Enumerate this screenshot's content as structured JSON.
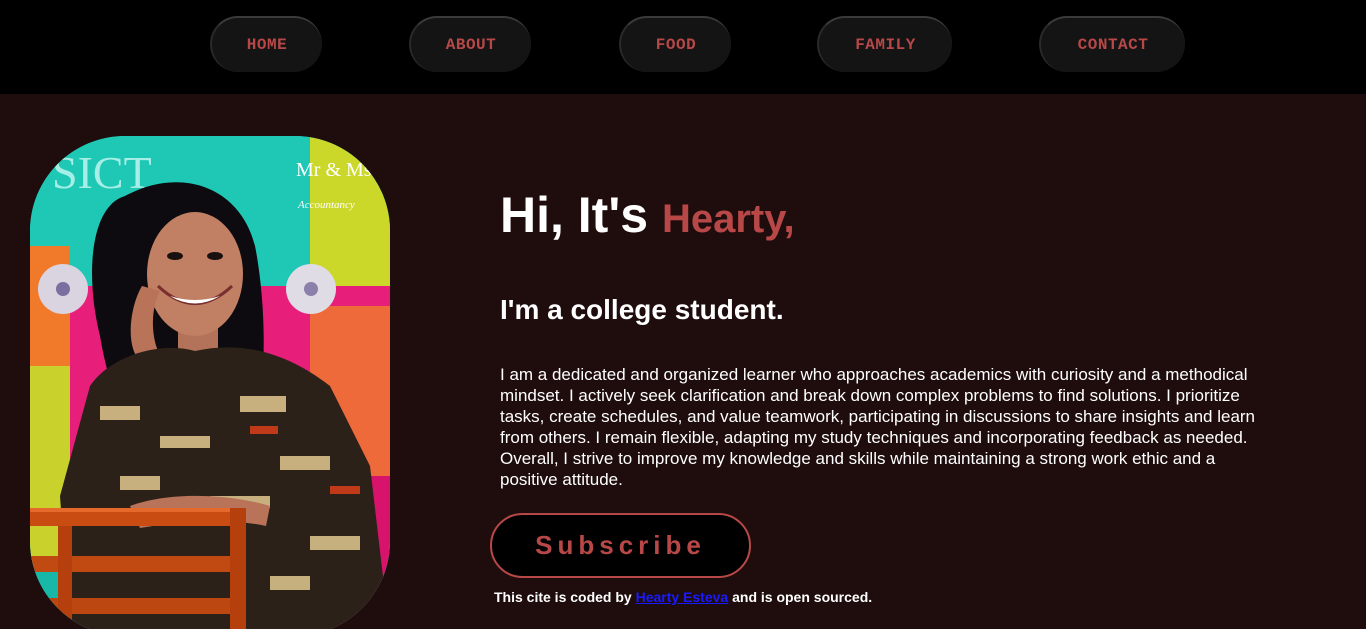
{
  "nav": {
    "items": [
      {
        "label": "HOME"
      },
      {
        "label": "ABOUT"
      },
      {
        "label": "FOOD"
      },
      {
        "label": "FAMILY"
      },
      {
        "label": "CONTACT"
      }
    ]
  },
  "portrait": {
    "backdrop_text": "SICT",
    "logo_mr_ms": "Mr & Ms",
    "logo_subtitle": "Accountancy"
  },
  "hero": {
    "greeting": "Hi, It's",
    "name": "Hearty,",
    "subtitle": "I'm a college student.",
    "bio": "I am a dedicated and organized learner who approaches academics with curiosity and a methodical mindset. I actively seek clarification and break down complex problems to find solutions. I prioritize tasks, create schedules, and value teamwork, participating in discussions to share insights and learn from others. I remain flexible, adapting my study techniques and incorporating feedback as needed. Overall, I strive to improve my knowledge and skills while maintaining a strong work ethic and a positive attitude.",
    "subscribe_label": "Subscribe"
  },
  "footer": {
    "prefix": "This cite is coded by",
    "link_text": "Hearty Esteva",
    "suffix": "and is open sourced."
  },
  "colors": {
    "accent": "#b84848",
    "background": "#1f0d0d",
    "nav_background": "#000000",
    "link": "#1a1aff"
  }
}
